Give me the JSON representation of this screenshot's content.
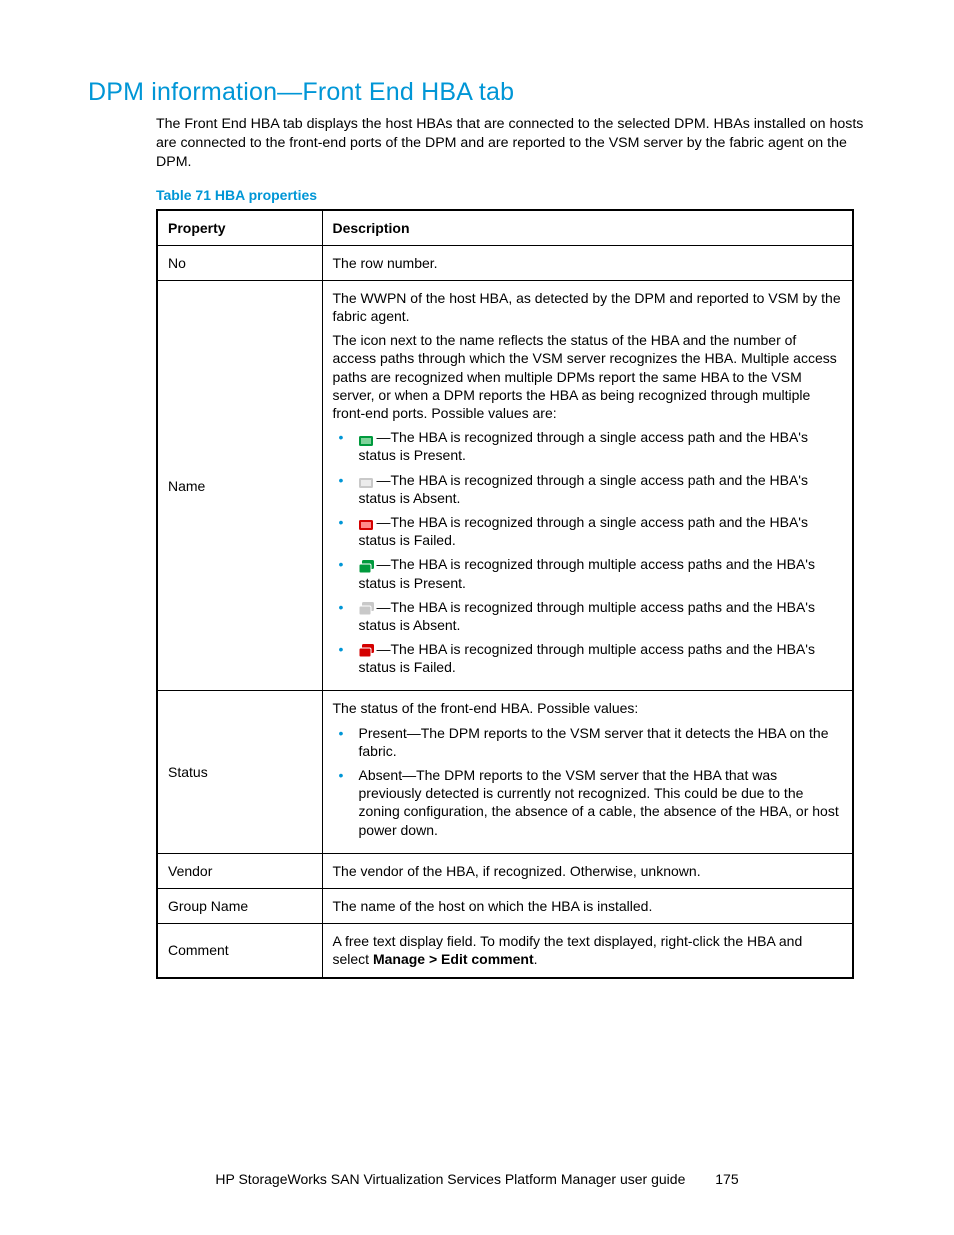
{
  "heading": "DPM information—Front End HBA tab",
  "intro": "The Front End HBA tab displays the host HBAs that are connected to the selected DPM. HBAs installed on hosts are connected to the front-end ports of the DPM and are reported to the VSM server by the fabric agent on the DPM.",
  "table_caption": "Table 71 HBA properties",
  "columns": {
    "property": "Property",
    "description": "Description"
  },
  "rows": {
    "no": {
      "property": "No",
      "description": "The row number."
    },
    "name": {
      "property": "Name",
      "p1": "The WWPN of the host HBA, as detected by the DPM and reported to VSM by the fabric agent.",
      "p2": "The icon next to the name reflects the status of the HBA and the number of access paths through which the VSM server recognizes the HBA. Multiple access paths are recognized when multiple DPMs report the same HBA to the VSM server, or when a DPM reports the HBA as being recognized through multiple front-end ports. Possible values are:",
      "items": [
        {
          "icon": "single-present",
          "text": "—The HBA is recognized through a single access path and the HBA's status is Present."
        },
        {
          "icon": "single-absent",
          "text": "—The HBA is recognized through a single access path and the HBA's status is Absent."
        },
        {
          "icon": "single-failed",
          "text": "—The HBA is recognized through a single access path and the HBA's status is Failed."
        },
        {
          "icon": "multi-present",
          "text": "—The HBA is recognized through multiple access paths and the HBA's status is Present."
        },
        {
          "icon": "multi-absent",
          "text": "—The HBA is recognized through multiple access paths and the HBA's status is Absent."
        },
        {
          "icon": "multi-failed",
          "text": "—The HBA is recognized through multiple access paths and the HBA's status is Failed."
        }
      ]
    },
    "status": {
      "property": "Status",
      "p1": "The status of the front-end HBA. Possible values:",
      "items": [
        "Present—The DPM reports to the VSM server that it detects the HBA on the fabric.",
        "Absent—The DPM reports to the VSM server that the HBA that was previously detected is currently not recognized. This could be due to the zoning configuration, the absence of a cable, the absence of the HBA, or host power down."
      ]
    },
    "vendor": {
      "property": "Vendor",
      "description": "The vendor of the HBA, if recognized. Otherwise, unknown."
    },
    "group_name": {
      "property": "Group Name",
      "description": "The name of the host on which the HBA is installed."
    },
    "comment": {
      "property": "Comment",
      "prefix": "A free text display field. To modify the text displayed, right-click the HBA and select ",
      "bold": "Manage > Edit comment",
      "suffix": "."
    }
  },
  "footer": {
    "title": "HP StorageWorks SAN Virtualization Services Platform Manager user guide",
    "page": "175"
  }
}
